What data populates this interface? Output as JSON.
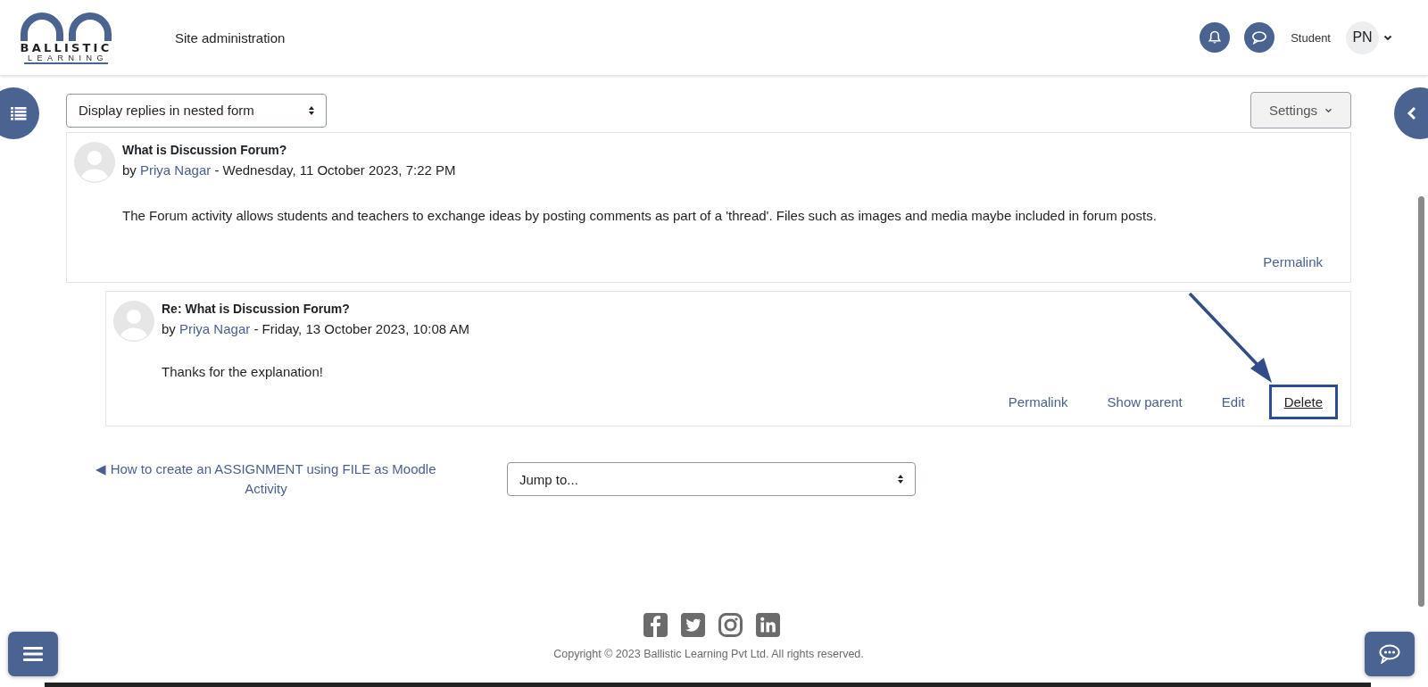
{
  "header": {
    "logo": {
      "word": "BALLISTIC",
      "sub": "LEARNING"
    },
    "nav_link": "Site administration",
    "role": "Student",
    "avatar": "PN"
  },
  "display_mode": {
    "value": "Display replies in nested form"
  },
  "settings_button": "Settings",
  "posts": [
    {
      "subject": "What is Discussion Forum?",
      "by": "by",
      "author": "Priya Nagar",
      "date": "- Wednesday, 11 October 2023, 7:22 PM",
      "body": "The Forum activity allows students and teachers to exchange ideas by posting comments as part of a 'thread'. Files such as images and media maybe included in forum posts.",
      "actions": [
        {
          "label": "Permalink",
          "highlighted": false
        }
      ],
      "replies": [
        {
          "subject": "Re: What is Discussion Forum?",
          "by": "by",
          "author": "Priya Nagar",
          "date": "- Friday, 13 October 2023, 10:08 AM",
          "body": "Thanks for the explanation!",
          "actions": [
            {
              "label": "Permalink",
              "highlighted": false
            },
            {
              "label": "Show parent",
              "highlighted": false
            },
            {
              "label": "Edit",
              "highlighted": false
            },
            {
              "label": "Delete",
              "highlighted": true
            }
          ]
        }
      ]
    }
  ],
  "navigation": {
    "previous_link": "◀ How to create an ASSIGNMENT using FILE as Moodle Activity",
    "jump_to": {
      "value": "Jump to..."
    }
  },
  "footer": {
    "copyright": "Copyright © 2023 Ballistic Learning Pvt Ltd. All rights reserved."
  }
}
